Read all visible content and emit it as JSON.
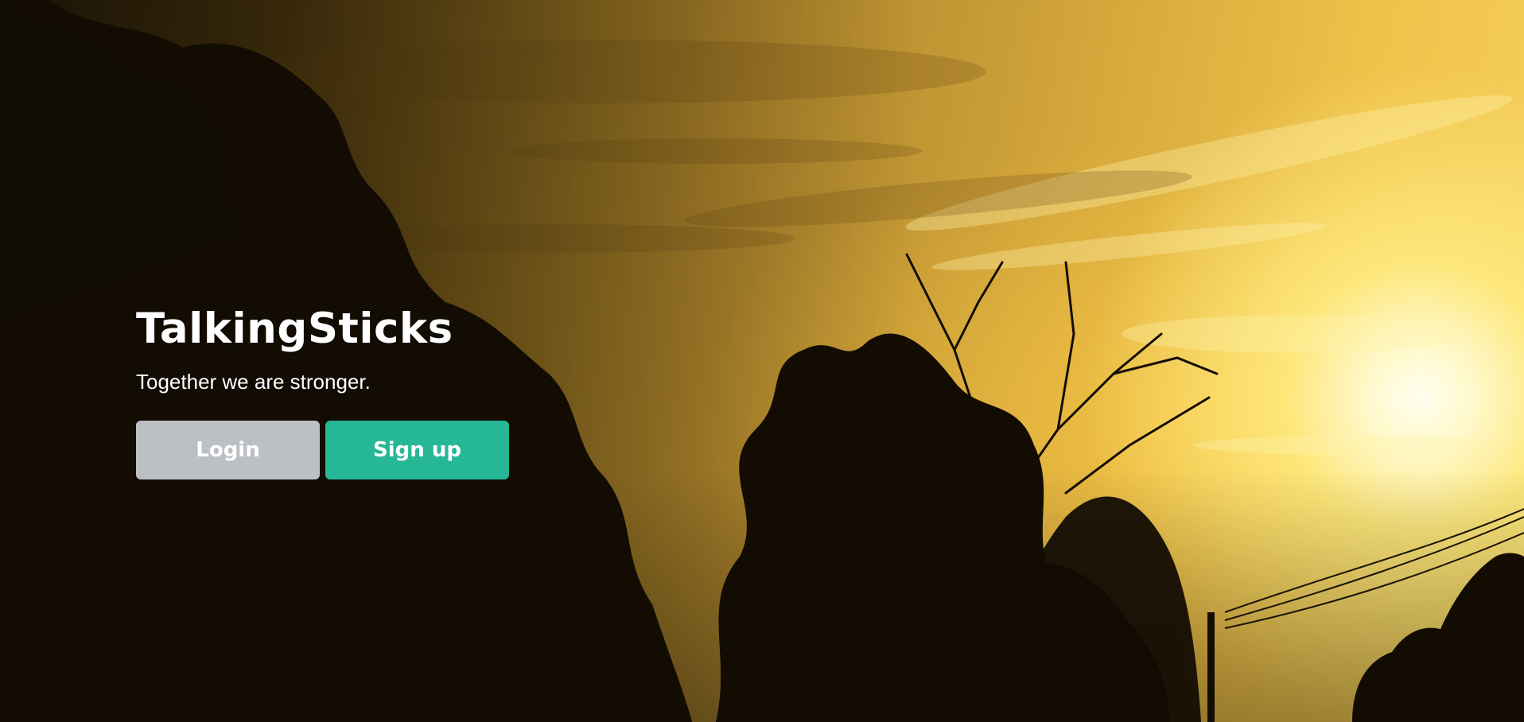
{
  "hero": {
    "brand": "TalkingSticks",
    "tagline": "Together we are stronger."
  },
  "actions": {
    "login_label": "Login",
    "signup_label": "Sign up"
  },
  "colors": {
    "login_button": "#bcc0c4",
    "signup_button": "#26b797",
    "text": "#ffffff"
  }
}
